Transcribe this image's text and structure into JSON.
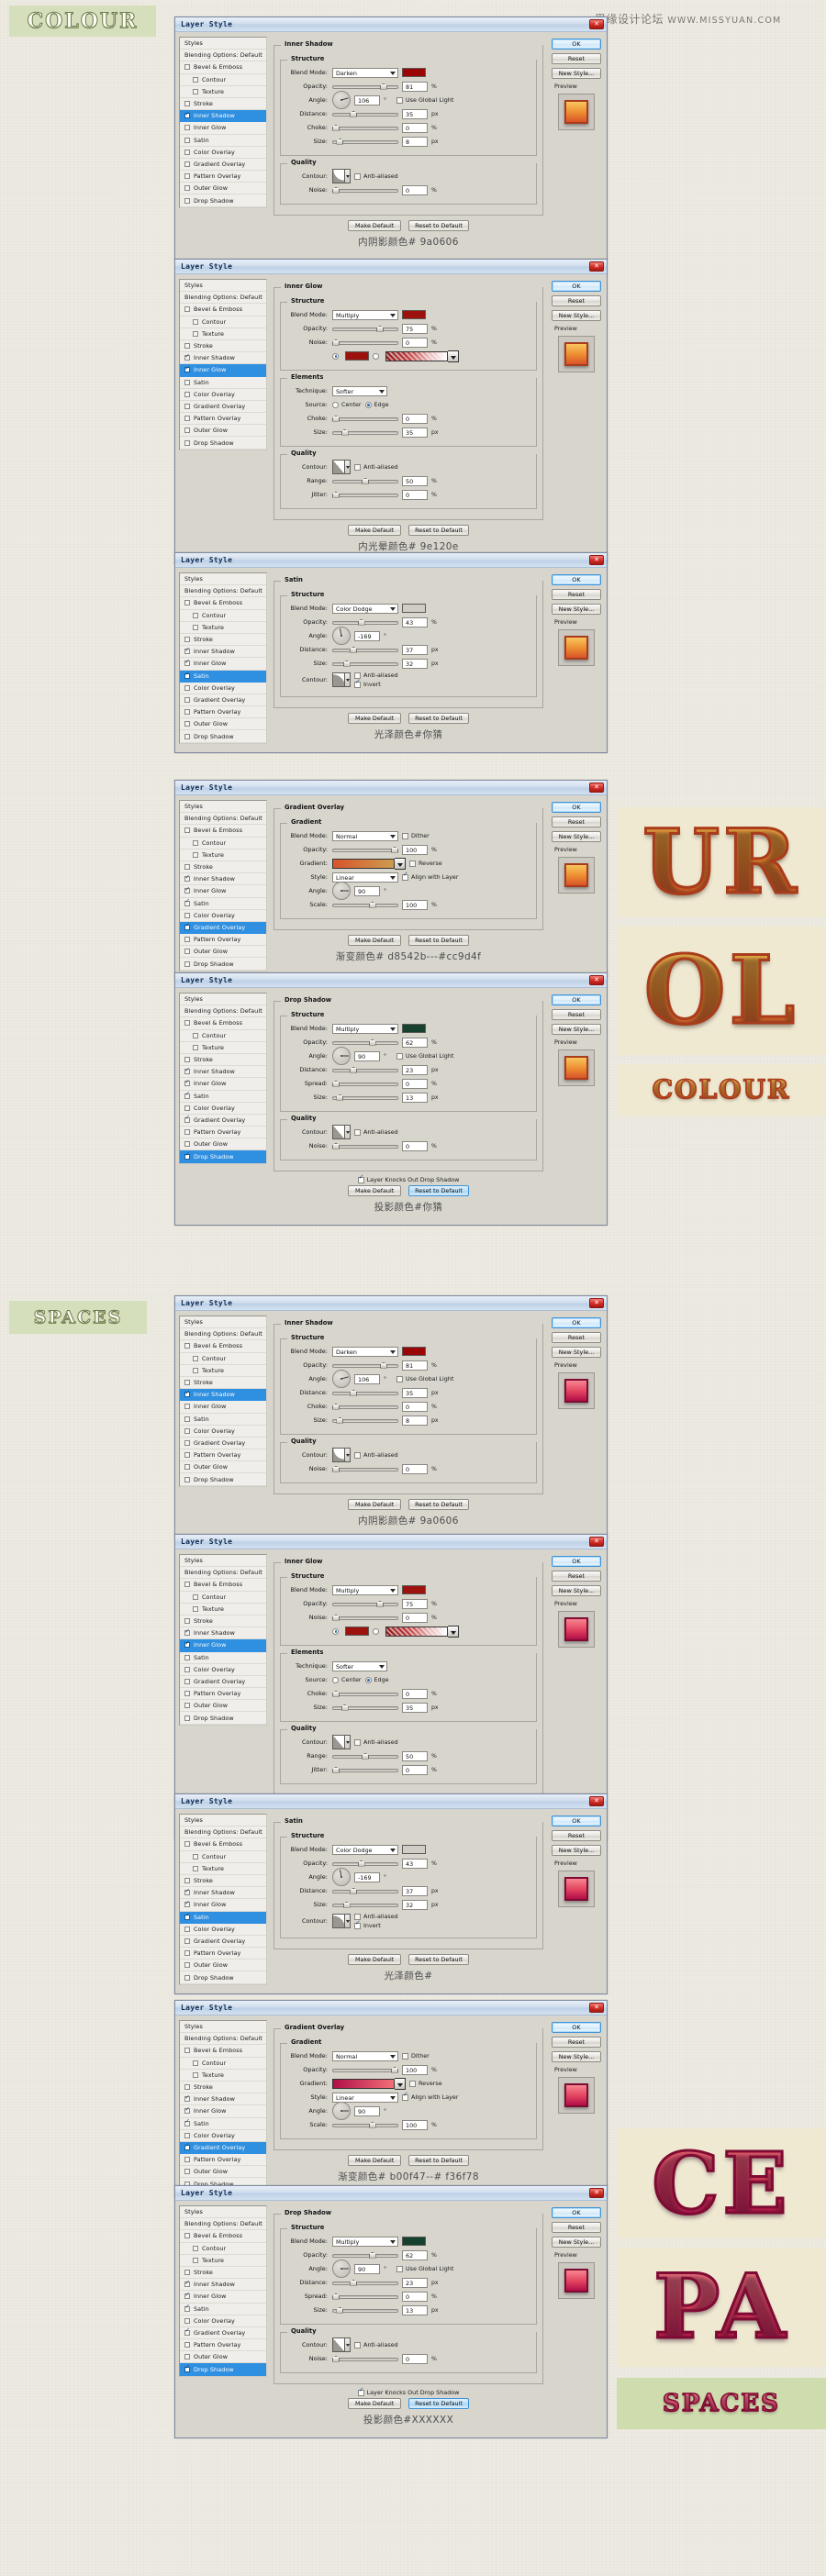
{
  "watermark": {
    "cn": "思缘设计论坛",
    "en": "WWW.MISSYUAN.COM"
  },
  "wordart": {
    "colour": "COLOUR",
    "spaces": "SPACES",
    "preview_ur": "UR",
    "preview_ol": "OL",
    "preview_colour_final": "COLOUR",
    "preview_ce": "CE",
    "preview_pa": "PA",
    "preview_spaces_final": "SPACES"
  },
  "dialog": {
    "title": "Layer Style",
    "close": "✕",
    "buttons": {
      "ok": "OK",
      "reset": "Reset",
      "new_style": "New Style...",
      "preview": "Preview",
      "make_default": "Make Default",
      "reset_to_default": "Reset to Default"
    },
    "styles_header": "Styles",
    "blending_options": "Blending Options: Default",
    "style_items": [
      "Bevel & Emboss",
      "Contour",
      "Texture",
      "Stroke",
      "Inner Shadow",
      "Inner Glow",
      "Satin",
      "Color Overlay",
      "Gradient Overlay",
      "Pattern Overlay",
      "Outer Glow",
      "Drop Shadow"
    ]
  },
  "labels": {
    "structure": "Structure",
    "quality": "Quality",
    "elements": "Elements",
    "gradient": "Gradient",
    "blend_mode": "Blend Mode:",
    "opacity": "Opacity:",
    "angle": "Angle:",
    "distance": "Distance:",
    "choke": "Choke:",
    "spread": "Spread:",
    "size": "Size:",
    "contour": "Contour:",
    "noise": "Noise:",
    "range": "Range:",
    "jitter": "Jitter:",
    "technique": "Technique:",
    "source": "Source:",
    "style": "Style:",
    "scale": "Scale:",
    "anti_aliased": "Anti-aliased",
    "invert": "Invert",
    "dither": "Dither",
    "reverse": "Reverse",
    "align_with_layer": "Align with Layer",
    "use_global_light": "Use Global Light",
    "layer_knocks_out": "Layer Knocks Out Drop Shadow",
    "center": "Center",
    "edge": "Edge",
    "deg": "°",
    "pct": "%",
    "px": "px"
  },
  "panels": [
    {
      "id": "colour-inner-shadow",
      "effect": "Inner Shadow",
      "selected": "Inner Shadow",
      "checked": [
        "Inner Shadow"
      ],
      "blend_mode": "Darken",
      "color": "#9a0606",
      "opacity": "81",
      "angle": "106",
      "angle_deg": 106,
      "use_global_light": false,
      "distance": "35",
      "choke": "0",
      "size": "8",
      "anti_aliased": false,
      "noise": "0",
      "caption": "内阴影颜色# 9a0606",
      "thumb": "orange"
    },
    {
      "id": "colour-inner-glow",
      "effect": "Inner Glow",
      "selected": "Inner Glow",
      "checked": [
        "Inner Shadow",
        "Inner Glow"
      ],
      "blend_mode": "Multiply",
      "color": "#9e120e",
      "opacity": "75",
      "noise": "0",
      "technique": "Softer",
      "source": "Edge",
      "choke": "0",
      "size": "35",
      "anti_aliased": false,
      "range": "50",
      "jitter": "0",
      "caption": "内光晕颜色# 9e120e",
      "thumb": "orange"
    },
    {
      "id": "colour-satin",
      "effect": "Satin",
      "selected": "Satin",
      "checked": [
        "Inner Shadow",
        "Inner Glow",
        "Satin"
      ],
      "blend_mode": "Color Dodge",
      "color": "#cfcdc6",
      "opacity": "43",
      "angle": "-169",
      "angle_deg": -169,
      "distance": "37",
      "size": "32",
      "anti_aliased": false,
      "invert": true,
      "caption": "光泽颜色#你猜",
      "thumb": "orange"
    },
    {
      "id": "colour-gradient-overlay",
      "effect": "Gradient Overlay",
      "selected": "Gradient Overlay",
      "checked": [
        "Inner Shadow",
        "Inner Glow",
        "Satin",
        "Gradient Overlay"
      ],
      "blend_mode": "Normal",
      "dither": false,
      "opacity": "100",
      "gradient_from": "#d8542b",
      "gradient_to": "#cc9d4f",
      "reverse": false,
      "style": "Linear",
      "align_with_layer": true,
      "angle": "90",
      "angle_deg": 90,
      "scale": "100",
      "caption": "渐变颜色# d8542b---#cc9d4f",
      "thumb": "orange"
    },
    {
      "id": "colour-drop-shadow",
      "effect": "Drop Shadow",
      "selected": "Drop Shadow",
      "checked": [
        "Inner Shadow",
        "Inner Glow",
        "Satin",
        "Gradient Overlay",
        "Drop Shadow"
      ],
      "blend_mode": "Multiply",
      "color": "#17412f",
      "opacity": "62",
      "angle": "90",
      "angle_deg": 90,
      "use_global_light": false,
      "distance": "23",
      "spread": "0",
      "size": "13",
      "anti_aliased": false,
      "noise": "0",
      "layer_knocks_out": true,
      "caption": "投影颜色#你猜",
      "thumb": "orange"
    },
    {
      "id": "spaces-inner-shadow",
      "effect": "Inner Shadow",
      "selected": "Inner Shadow",
      "checked": [
        "Inner Shadow"
      ],
      "blend_mode": "Darken",
      "color": "#9a0606",
      "opacity": "81",
      "angle": "106",
      "angle_deg": 106,
      "use_global_light": false,
      "distance": "35",
      "choke": "0",
      "size": "8",
      "anti_aliased": false,
      "noise": "0",
      "caption": "内阴影颜色# 9a0606",
      "thumb": "pink"
    },
    {
      "id": "spaces-inner-glow",
      "effect": "Inner Glow",
      "selected": "Inner Glow",
      "checked": [
        "Inner Shadow",
        "Inner Glow"
      ],
      "blend_mode": "Multiply",
      "color": "#9e120e",
      "opacity": "75",
      "noise": "0",
      "technique": "Softer",
      "source": "Edge",
      "choke": "0",
      "size": "35",
      "anti_aliased": false,
      "range": "50",
      "jitter": "0",
      "caption": "内光晕颜色# 9e120e",
      "thumb": "pink"
    },
    {
      "id": "spaces-satin",
      "effect": "Satin",
      "selected": "Satin",
      "checked": [
        "Inner Shadow",
        "Inner Glow",
        "Satin"
      ],
      "blend_mode": "Color Dodge",
      "color": "#cfcdc6",
      "opacity": "43",
      "angle": "-169",
      "angle_deg": -169,
      "distance": "37",
      "size": "32",
      "anti_aliased": false,
      "invert": true,
      "caption": "光泽颜色#",
      "thumb": "pink"
    },
    {
      "id": "spaces-gradient-overlay",
      "effect": "Gradient Overlay",
      "selected": "Gradient Overlay",
      "checked": [
        "Inner Shadow",
        "Inner Glow",
        "Satin",
        "Gradient Overlay"
      ],
      "blend_mode": "Normal",
      "dither": false,
      "opacity": "100",
      "gradient_from": "#b00f47",
      "gradient_to": "#f36f78",
      "reverse": false,
      "style": "Linear",
      "align_with_layer": true,
      "angle": "90",
      "angle_deg": 90,
      "scale": "100",
      "caption": "渐变颜色# b00f47--# f36f78",
      "thumb": "pink"
    },
    {
      "id": "spaces-drop-shadow",
      "effect": "Drop Shadow",
      "selected": "Drop Shadow",
      "checked": [
        "Inner Shadow",
        "Inner Glow",
        "Satin",
        "Gradient Overlay",
        "Drop Shadow"
      ],
      "blend_mode": "Multiply",
      "color": "#17412f",
      "opacity": "62",
      "angle": "90",
      "angle_deg": 90,
      "use_global_light": false,
      "distance": "23",
      "spread": "0",
      "size": "13",
      "anti_aliased": false,
      "noise": "0",
      "layer_knocks_out": true,
      "caption": "投影颜色#XXXXXX",
      "thumb": "pink"
    }
  ]
}
